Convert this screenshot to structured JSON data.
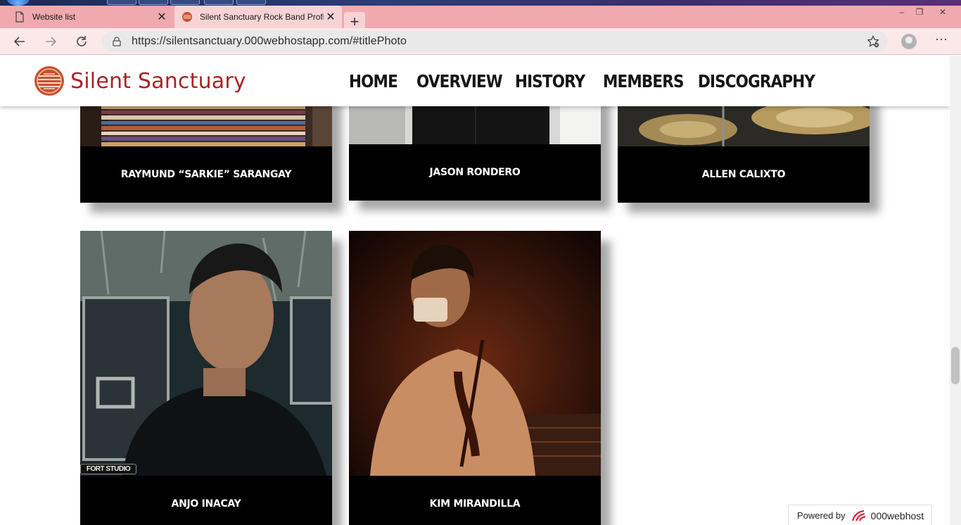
{
  "browser": {
    "tabs": [
      {
        "title": "Website list",
        "icon": "page-icon",
        "active": false
      },
      {
        "title": "Silent Sanctuary Rock Band Profi",
        "icon": "site-favicon",
        "active": true
      }
    ],
    "new_tab_label": "+",
    "close_label": "✕",
    "url": "https://silentsanctuary.000webhostapp.com/#titlePhoto",
    "window_controls": [
      "–",
      "❐",
      "✕"
    ]
  },
  "site": {
    "brand": "Silent Sanctuary",
    "nav": [
      "HOME",
      "OVERVIEW",
      "HISTORY",
      "MEMBERS",
      "DISCOGRAPHY"
    ],
    "brand_color": "#a82424"
  },
  "members": [
    {
      "name": "RAYMUND “SARKIE” SARANGAY",
      "photo": "striped-shirt-photo"
    },
    {
      "name": "JASON RONDERO",
      "photo": "dark-shirt-photo"
    },
    {
      "name": "ALLEN CALIXTO",
      "photo": "drum-cymbals-photo"
    },
    {
      "name": "ANJO INACAY",
      "photo": "portrait-anjo-photo",
      "watermark": "FORT STUDIO"
    },
    {
      "name": "KIM MIRANDILLA",
      "photo": "violinist-photo"
    }
  ],
  "footer_badge": {
    "label": "Powered by",
    "host": "000webhost"
  }
}
